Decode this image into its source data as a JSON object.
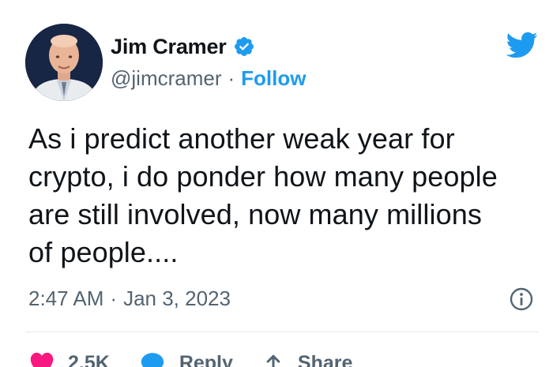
{
  "author": {
    "display_name": "Jim Cramer",
    "handle": "@jimcramer",
    "separator": "·",
    "follow_label": "Follow",
    "verified": true
  },
  "tweet": {
    "text": "As i predict another weak year for\ncrypto, i do ponder how many people\nare still involved, now many millions\nof people....",
    "time": "2:47 AM",
    "date_separator": "·",
    "date": "Jan 3, 2023"
  },
  "actions": {
    "like_count": "2.5K",
    "reply_label": "Reply",
    "share_label": "Share"
  },
  "colors": {
    "accent": "#1d9bf0",
    "like": "#f91880",
    "text": "#0f1419",
    "muted": "#536471"
  },
  "icons": {
    "logo": "twitter-bird-icon",
    "verified": "verified-badge-icon",
    "info": "info-icon",
    "like": "heart-icon",
    "reply": "reply-bubble-icon",
    "share": "share-arrow-icon"
  }
}
